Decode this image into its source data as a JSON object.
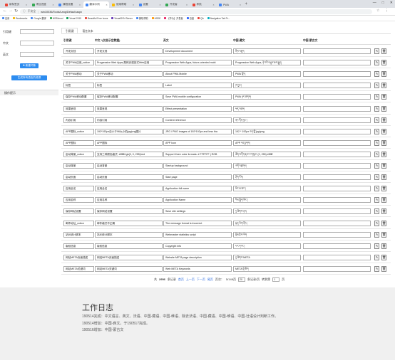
{
  "browser": {
    "tabs": [
      {
        "label": "新标签页",
        "color": "#ea4335"
      },
      {
        "label": "项目进度",
        "color": "#34a853"
      },
      {
        "label": "课程设置",
        "color": "#4285f4"
      },
      {
        "label": "翻译示例",
        "color": "#4285f4",
        "active": true
      },
      {
        "label": "使用帮助",
        "color": "#fbbc05"
      },
      {
        "label": "设置",
        "color": "#4285f4"
      },
      {
        "label": "开发者",
        "color": "#34a853"
      },
      {
        "label": "导航",
        "color": "#ea4335"
      },
      {
        "label": "PWA",
        "color": "#4285f4"
      }
    ],
    "new_tab": "+",
    "url_prefix": "不安全",
    "url": "win10036/Tools/Lang/Default.aspx",
    "bookmarks": [
      "应用",
      "Bookmarks",
      "Google 翻译",
      "W3School",
      "Visual 2019",
      "Beautiful Free Icons",
      "VisualSVN Server",
      "微软帮助",
      "HSDE",
      "【华为】开发者",
      "百度",
      "QA",
      "Navigation Tab Pr..."
    ],
    "window_controls": [
      "—",
      "□",
      "✕"
    ]
  },
  "sidebar": {
    "key_label": "引用键",
    "zh_label": "中文",
    "en_label": "英文",
    "add_button": "✚ 新建词条",
    "generate_button": "生成所有语言的资源",
    "section_title": "操作提示"
  },
  "main": {
    "tabs": [
      "引用键",
      "语言文本"
    ],
    "columns": [
      "引用键",
      "中文 *(仅显示空数据)",
      "英文",
      "中国-藏文",
      "中国-蒙古文",
      ""
    ],
    "rows": [
      {
        "key": "开发文档",
        "zh": "开发文档",
        "en": "Development document",
        "bo": "ཞིབ་འཇུག",
        "mn": ""
      },
      {
        "key": "关于PWA应用_notice",
        "zh": "Progressive Web Apps,是网页渲染式Web应用",
        "en": "Progressive Web Apps, future-oriented mobi",
        "bo": "Progressive Web Apps, ཉེ་བའི་འཕྲུལ་ཆས་རྒྱུད།",
        "mn": ""
      },
      {
        "key": "关于PWA移动",
        "zh": "关于PWA移动",
        "en": "About PWA Mobile",
        "bo": "PWA སྐོར།",
        "mn": ""
      },
      {
        "key": "标签",
        "zh": "标签",
        "en": "Label",
        "bo": "ཁ་བྱང་།",
        "mn": ""
      },
      {
        "key": "保存PWA移动配置",
        "zh": "保存PWA移动配置",
        "en": "Save PWA mobile configuration",
        "bo": "PWA ཉར་ཚགས།",
        "mn": ""
      },
      {
        "key": "效果呈现",
        "zh": "效果呈现",
        "en": "Effect presentation",
        "bo": "ཕན་འབྲས།",
        "mn": ""
      },
      {
        "key": "内容引用",
        "zh": "内容引用",
        "en": "Content reference",
        "bo": "ནང་དོན་ལུང་།",
        "mn": ""
      },
      {
        "key": "APP图标_notice",
        "zh": "192*192px自小于96大小的jpg/png图片",
        "en": "JPG \\ PNG images of 192*192px and less tha",
        "bo": "192 * 192px ཅན་གྱི་jpg/png",
        "mn": ""
      },
      {
        "key": "APP图标",
        "zh": "APP图标",
        "en": "APP Icon",
        "bo": "APP བརྡ་རྟགས།",
        "mn": ""
      },
      {
        "key": "启动背景_notice",
        "zh": "支持三种颜色格式: #ffffff/rgb(0, 0, 255)/red",
        "en": "Support three color formats: # FFFFFF | RGB",
        "bo": "ཚོན་མདོག་རྣམ་པ་གསུམ་ (0, 255) #ffffff",
        "mn": ""
      },
      {
        "key": "启动背景",
        "zh": "启动背景",
        "en": "Startup background",
        "bo": "འགོ་འཛུགས།",
        "mn": ""
      },
      {
        "key": "启动页面",
        "zh": "启动页面",
        "en": "Start page",
        "bo": "ཤོག་ངོས།",
        "mn": ""
      },
      {
        "key": "应用全名",
        "zh": "应用全名",
        "en": "Application full name",
        "bo": "མིང་ཆ་ཚང་།",
        "mn": ""
      },
      {
        "key": "应用名称",
        "zh": "应用名称",
        "en": "Application Name",
        "bo": "རིམ་སྒྲིག་མིང་།",
        "mn": ""
      },
      {
        "key": "保存网站设置",
        "zh": "保存网站设置",
        "en": "Save site settings",
        "bo": "དྲ་ཚིགས་ཉར།",
        "mn": ""
      },
      {
        "key": "邮件地址_notice",
        "zh": "邮件格式不正确",
        "en": "The message format is incorrect",
        "bo": "སྐད་ཡིག་ནོར།",
        "mn": ""
      },
      {
        "key": "站长统计脚本",
        "zh": "站长统计脚本",
        "en": "Webmaster statistics script",
        "bo": "སྡོམ་རྩིས་ཡིག",
        "mn": ""
      },
      {
        "key": "版权信息",
        "zh": "版权信息",
        "en": "Copyright info",
        "bo": "པར་དབང་།",
        "mn": ""
      },
      {
        "key": "网站META页面描述",
        "zh": "网站META页面描述",
        "en": "Website META page description",
        "bo": "དྲ་ཚིགས་META",
        "mn": ""
      },
      {
        "key": "网站META关键词",
        "zh": "网站META关键词",
        "en": "Web META Keywords",
        "bo": "META་ལྡེ་ཚིག",
        "mn": ""
      }
    ],
    "edit_icon": "✎",
    "delete_icon": "🗑"
  },
  "pager": {
    "total_prefix": "共",
    "total": "2956",
    "total_suffix": "条记录",
    "first": "首页",
    "prev": "上一页",
    "next": "下一页",
    "last": "尾页",
    "page_label": "页次：",
    "page_current": "1",
    "page_sep": "/",
    "page_total": "148",
    "page_unit": "页",
    "page_size": "20",
    "page_size_unit": "条记录/页",
    "goto_label": "转到第",
    "goto_value": "1",
    "goto_unit": "页"
  },
  "footer": {
    "title": "工作日志",
    "lines": [
      "190514完成：中文语言、英文、法语、中国-藏语、中国-维语、除去法语、中国-藏语、中国-维语、中国-壮语设计判断工作。",
      "190514增加：中国-彝文，于190517完成。",
      "190516增加：中国-蒙古文"
    ]
  }
}
